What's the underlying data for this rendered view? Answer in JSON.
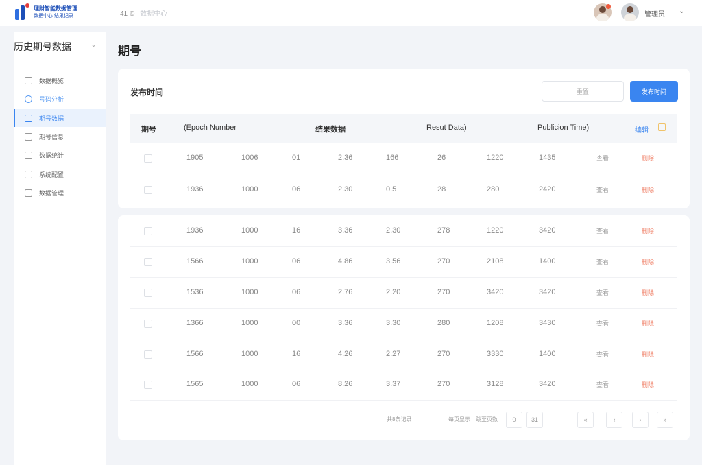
{
  "header": {
    "logo_line1": "理财智能数据管理",
    "logo_line2": "数据中心 结果记录",
    "nav_primary": "41 ©",
    "nav_secondary": "数据中心",
    "username": "管理员"
  },
  "sidebar": {
    "title": "历史期号数据",
    "items": [
      {
        "label": "数据概览",
        "state": "normal"
      },
      {
        "label": "号码分析",
        "state": "highlight"
      },
      {
        "label": "期号数据",
        "state": "active"
      },
      {
        "label": "期号信息",
        "state": "normal"
      },
      {
        "label": "数据统计",
        "state": "normal"
      },
      {
        "label": "系统配置",
        "state": "normal"
      },
      {
        "label": "数据管理",
        "state": "normal"
      }
    ]
  },
  "page": {
    "title": "期号"
  },
  "filter": {
    "label": "发布时间",
    "reset_label": "重置",
    "publish_label": "发布时间"
  },
  "table": {
    "headers": {
      "col_issue_cn": "期号",
      "col_issue_en": "(Epoch Number",
      "col_result_cn": "结果数据",
      "col_result_en": "Resut Data)",
      "col_time_en": "Publicion Time)",
      "col_action": "编辑"
    },
    "action_label": "查看",
    "delete_label": "删除",
    "rows": [
      [
        "1905",
        "1006",
        "01",
        "2.36",
        "166",
        "26",
        "1220",
        "1435"
      ],
      [
        "1936",
        "1000",
        "06",
        "2.30",
        "0.5",
        "28",
        "280",
        "2420"
      ],
      [
        "1936",
        "1000",
        "16",
        "3.36",
        "2.30",
        "278",
        "1220",
        "3420"
      ],
      [
        "1566",
        "1000",
        "06",
        "4.86",
        "3.56",
        "270",
        "2108",
        "1400"
      ],
      [
        "1536",
        "1000",
        "06",
        "2.76",
        "2.20",
        "270",
        "3420",
        "3420"
      ],
      [
        "1366",
        "1000",
        "00",
        "3.36",
        "3.30",
        "280",
        "1208",
        "3430"
      ],
      [
        "1566",
        "1000",
        "16",
        "4.26",
        "2.27",
        "270",
        "3330",
        "1400"
      ],
      [
        "1565",
        "1000",
        "06",
        "8.26",
        "3.37",
        "270",
        "3128",
        "3420"
      ]
    ]
  },
  "pagination": {
    "total_text": "共8条记录",
    "page_size_text": "每页显示",
    "jump_text": "跳至页数",
    "page_input_1": "0",
    "page_input_2": "31",
    "nav_first": "«",
    "nav_prev": "‹",
    "nav_next": "›",
    "nav_last": "»"
  },
  "colors": {
    "accent": "#3a85f0",
    "delete": "#f0846c",
    "background": "#f2f4f8"
  }
}
